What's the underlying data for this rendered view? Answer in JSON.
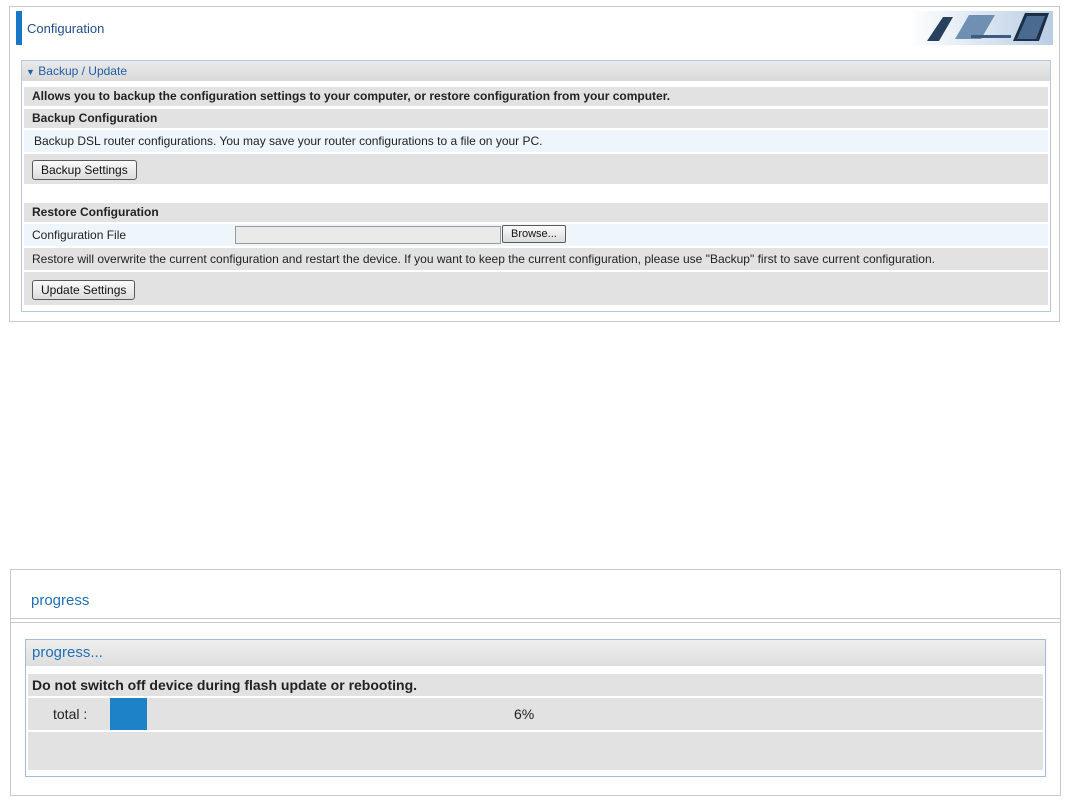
{
  "config": {
    "title": "Configuration",
    "section_title": "Backup / Update",
    "intro": "Allows you to backup the configuration settings to your computer, or restore configuration from your computer.",
    "backup": {
      "heading": "Backup Configuration",
      "description": "Backup DSL router configurations. You may save your router configurations to a file on your PC.",
      "button_label": "Backup Settings"
    },
    "restore": {
      "heading": "Restore Configuration",
      "file_label": "Configuration File",
      "file_value": "",
      "browse_label": "Browse...",
      "warning": "Restore will overwrite the current configuration and restart the device. If you want to keep the current configuration, please use \"Backup\" first to save current configuration.",
      "button_label": "Update Settings"
    }
  },
  "progress": {
    "page_title": "progress",
    "section_title": "progress...",
    "warning": "Do not switch off device during flash update or rebooting.",
    "total_label": "total :",
    "percent_text": "6%",
    "percent_value": 4,
    "bar_color": "#1e82c8"
  },
  "colors": {
    "accent": "#1877c7",
    "title_blue": "#1f4f8c"
  }
}
